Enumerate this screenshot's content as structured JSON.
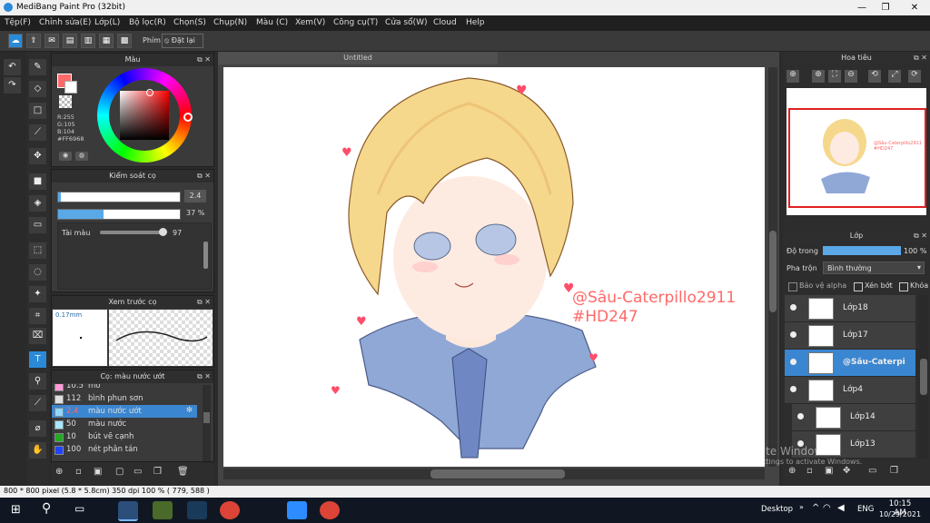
{
  "window": {
    "title": "MediBang Paint Pro (32bit)",
    "controls": [
      "—",
      "❐",
      "✕"
    ]
  },
  "menu": [
    "Tệp(F)",
    "Chỉnh sửa(E)",
    "Lớp(L)",
    "Bộ lọc(R)",
    "Chọn(S)",
    "Chụp(N)",
    "Màu (C)",
    "Xem(V)",
    "Công cụ(T)",
    "Cửa sổ(W)",
    "Cloud",
    "Help"
  ],
  "toolbar": {
    "key_label": "Phím",
    "reset_label": "Đặt lại"
  },
  "color_panel": {
    "title": "Màu",
    "r": "R:255",
    "g": "G:105",
    "b": "B:104",
    "hex": "#FF6968",
    "primary_color": "#ff6968"
  },
  "brush_control": {
    "title": "Kiểm soát cọ",
    "size_value": "2.4",
    "opacity_value": "37",
    "opacity_unit": "%",
    "opacity_fraction": 0.37,
    "size_fraction": 0.02,
    "material_label": "Tài màu",
    "material_value": "97",
    "material_fraction": 0.97
  },
  "brush_preview": {
    "title": "Xem trước cọ",
    "size_text": "0.17mm"
  },
  "brush_list": {
    "title": "Cọ: màu nước ướt",
    "items": [
      {
        "num": "10.5",
        "name": "mờ",
        "color": "#ff9ad6"
      },
      {
        "num": "112",
        "name": "bình phun sơn",
        "color": "#e0e0e0"
      },
      {
        "num": "2.4",
        "name": "màu nước ướt",
        "color": "#8fd8ff"
      },
      {
        "num": "50",
        "name": "màu nước",
        "color": "#a8e7ff"
      },
      {
        "num": "10",
        "name": "bút vẽ cạnh",
        "color": "#22aa22"
      },
      {
        "num": "100",
        "name": "nét phân tán",
        "color": "#2244ff"
      }
    ],
    "selected_index": 2
  },
  "canvas": {
    "tab_title": "Untitled",
    "signature_line1": "@Sâu-Caterpillo2911",
    "signature_line2": "#HD247",
    "signature_color": "#ff6968"
  },
  "navigator": {
    "title": "Hoa tiêu"
  },
  "layers_panel": {
    "title": "Lớp",
    "opacity_label": "Độ trong",
    "opacity_value": "100 %",
    "opacity_fraction": 1.0,
    "blend_label": "Pha trộn",
    "blend_value": "Bình thường",
    "protect_alpha": "Bảo vệ alpha",
    "clip": "Xén bớt",
    "lock": "Khóa",
    "layers": [
      {
        "name": "Lớp18",
        "selected": false
      },
      {
        "name": "Lớp17",
        "selected": false
      },
      {
        "name": "@Sâu-Caterpi",
        "selected": true
      },
      {
        "name": "Lớp4",
        "selected": false
      },
      {
        "name": "Lớp14",
        "selected": false
      },
      {
        "name": "Lớp13",
        "selected": false
      }
    ]
  },
  "status": {
    "text": "800 * 800 pixel  (5.8 * 5.8cm)  350 dpi  100 %  ( 779, 588 )"
  },
  "watermark": {
    "line1": "Activate Windows",
    "line2": "Go to Settings to activate Windows."
  },
  "taskbar": {
    "desktop_label": "Desktop",
    "lang": "ENG",
    "time": "10:15 AM",
    "date": "10/29/2021"
  }
}
